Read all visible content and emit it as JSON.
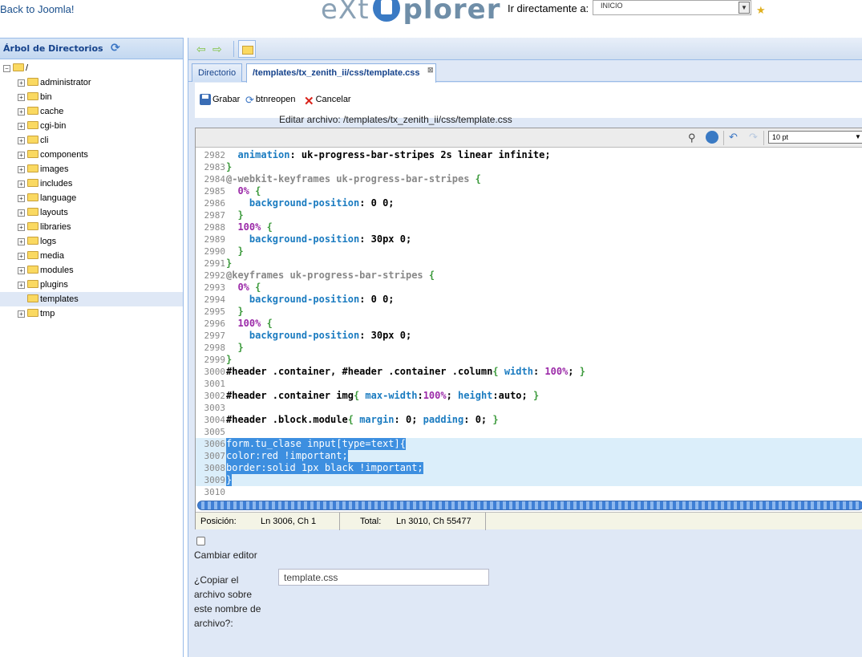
{
  "header": {
    "back_link": "Back to Joomla!",
    "logo_left": "eXt",
    "logo_right": "plorer",
    "goto_label": "Ir directamente a:",
    "goto_value": "INICIO"
  },
  "tree": {
    "title": "Árbol de Directorios",
    "root": "/",
    "items": [
      {
        "label": "administrator"
      },
      {
        "label": "bin"
      },
      {
        "label": "cache"
      },
      {
        "label": "cgi-bin"
      },
      {
        "label": "cli"
      },
      {
        "label": "components"
      },
      {
        "label": "images"
      },
      {
        "label": "includes"
      },
      {
        "label": "language"
      },
      {
        "label": "layouts"
      },
      {
        "label": "libraries"
      },
      {
        "label": "logs"
      },
      {
        "label": "media"
      },
      {
        "label": "modules"
      },
      {
        "label": "plugins"
      },
      {
        "label": "templates",
        "selected": true
      },
      {
        "label": "tmp"
      }
    ]
  },
  "tabs": {
    "dir": "Directorio",
    "file": "/templates/tx_zenith_ii/css/template.css"
  },
  "toolbar": {
    "save": "Grabar",
    "reopen": "btnreopen",
    "cancel": "Cancelar",
    "caption": "Editar archivo: /templates/tx_zenith_ii/css/template.css"
  },
  "editor": {
    "font_size": "10 pt",
    "lines": [
      {
        "n": "2982",
        "t": "  animation: uk-progress-bar-stripes 2s linear infinite;"
      },
      {
        "n": "2983",
        "t": "}"
      },
      {
        "n": "2984",
        "t": "@-webkit-keyframes uk-progress-bar-stripes {"
      },
      {
        "n": "2985",
        "t": "  0% {"
      },
      {
        "n": "2986",
        "t": "    background-position: 0 0;"
      },
      {
        "n": "2987",
        "t": "  }"
      },
      {
        "n": "2988",
        "t": "  100% {"
      },
      {
        "n": "2989",
        "t": "    background-position: 30px 0;"
      },
      {
        "n": "2990",
        "t": "  }"
      },
      {
        "n": "2991",
        "t": "}"
      },
      {
        "n": "2992",
        "t": "@keyframes uk-progress-bar-stripes {"
      },
      {
        "n": "2993",
        "t": "  0% {"
      },
      {
        "n": "2994",
        "t": "    background-position: 0 0;"
      },
      {
        "n": "2995",
        "t": "  }"
      },
      {
        "n": "2996",
        "t": "  100% {"
      },
      {
        "n": "2997",
        "t": "    background-position: 30px 0;"
      },
      {
        "n": "2998",
        "t": "  }"
      },
      {
        "n": "2999",
        "t": "}"
      },
      {
        "n": "3000",
        "t": "#header .container, #header .container .column{ width: 100%; }"
      },
      {
        "n": "3001",
        "t": ""
      },
      {
        "n": "3002",
        "t": "#header .container img{ max-width:100%; height:auto; }"
      },
      {
        "n": "3003",
        "t": ""
      },
      {
        "n": "3004",
        "t": "#header .block.module{ margin: 0; padding: 0; }"
      },
      {
        "n": "3005",
        "t": ""
      },
      {
        "n": "3006",
        "t": "form.tu_clase input[type=text]{",
        "hl": true
      },
      {
        "n": "3007",
        "t": "color:red !important;",
        "hl": true
      },
      {
        "n": "3008",
        "t": "border:solid 1px black !important;",
        "hl": true
      },
      {
        "n": "3009",
        "t": "}",
        "hl": true
      },
      {
        "n": "3010",
        "t": ""
      }
    ]
  },
  "status": {
    "pos_label": "Posición:",
    "pos_value": "Ln 3006, Ch 1",
    "total_label": "Total:",
    "total_value": "Ln 3010, Ch 55477"
  },
  "form": {
    "change_editor": "Cambiar editor",
    "copy_label": "¿Copiar el archivo sobre este nombre de archivo?:",
    "copy_value": "template.css"
  }
}
